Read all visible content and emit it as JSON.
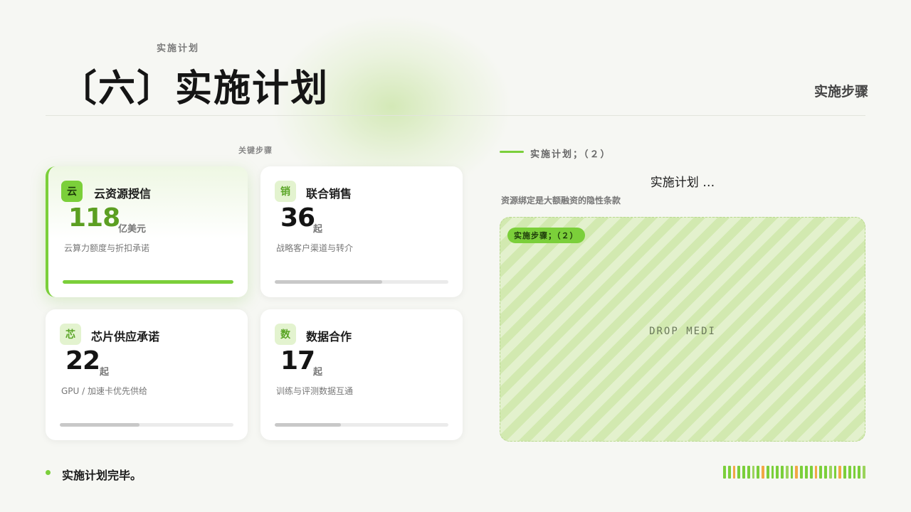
{
  "header": {
    "eyebrow": "实施计划",
    "title": "〔六〕实施计划",
    "right_label": "实施步骤"
  },
  "steps_section": {
    "label": "关键步骤",
    "cards": [
      {
        "icon": "云",
        "title": "云资源授信",
        "value": "118",
        "unit": "亿美元",
        "desc": "云算力额度与折扣承诺",
        "progress": 1.0,
        "active": true
      },
      {
        "icon": "销",
        "title": "联合销售",
        "value": "36",
        "unit": "起",
        "desc": "战略客户渠道与转介",
        "progress": 0.62,
        "active": false
      },
      {
        "icon": "芯",
        "title": "芯片供应承诺",
        "value": "22",
        "unit": "起",
        "desc": "GPU /  加速卡优先供给",
        "progress": 0.46,
        "active": false
      },
      {
        "icon": "数",
        "title": "数据合作",
        "value": "17",
        "unit": "起",
        "desc": "训练与评测数据互通",
        "progress": 0.38,
        "active": false
      }
    ]
  },
  "right_panel": {
    "heading": "实施计划；（２）",
    "center_title": "实施计划 …",
    "subtitle": "资源绑定是大额融资的隐性条款",
    "drop_chip": "实施步骤；（２）",
    "drop_text": "DROP MEDI"
  },
  "footer": {
    "text": "实施计划完毕。"
  },
  "colors": {
    "accent": "#7bcf3a",
    "stripes": [
      "#7bcf3a",
      "#7bcf3a",
      "#f0a844",
      "#7bcf3a",
      "#7bcf3a",
      "#7bcf3a",
      "#9bd45c",
      "#7bcf3a",
      "#f0a844",
      "#7bcf3a",
      "#7bcf3a",
      "#7bcf3a",
      "#7bcf3a",
      "#9bd45c",
      "#7bcf3a",
      "#f0a844",
      "#7bcf3a",
      "#7bcf3a",
      "#7bcf3a",
      "#f0a844",
      "#7bcf3a",
      "#7bcf3a",
      "#9bd45c",
      "#7bcf3a",
      "#f0a844",
      "#7bcf3a",
      "#7bcf3a",
      "#7bcf3a",
      "#7bcf3a",
      "#9bd45c"
    ]
  }
}
